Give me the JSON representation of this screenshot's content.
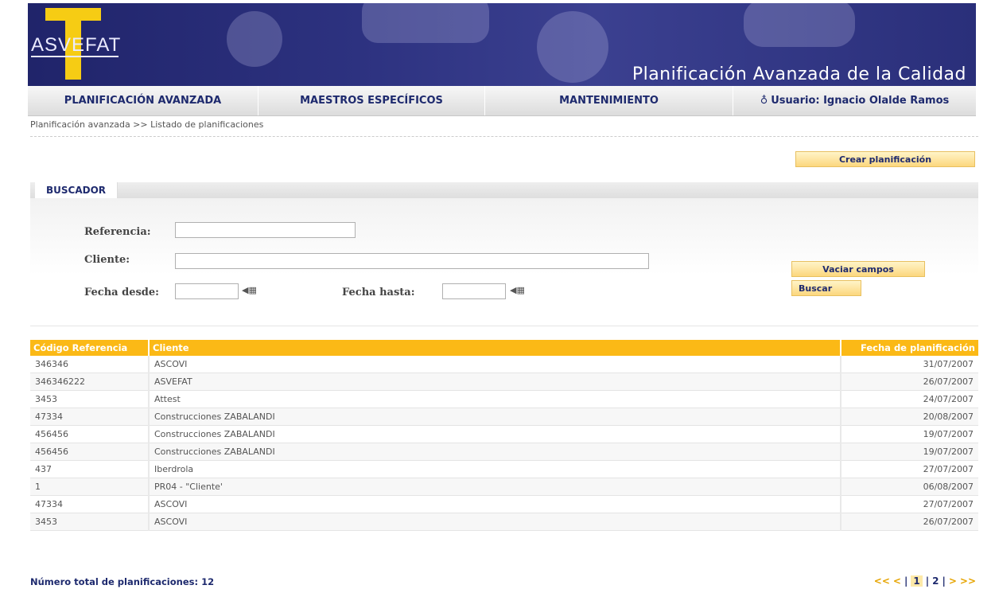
{
  "header": {
    "brand": "ASVEFAT",
    "title": "Planificación Avanzada de la Calidad"
  },
  "nav": {
    "items": [
      "PLANIFICACIÓN AVANZADA",
      "MAESTROS ESPECÍFICOS",
      "MANTENIMIENTO"
    ],
    "user": "Usuario: Ignacio Olalde Ramos"
  },
  "breadcrumb": "Planificación avanzada >> Listado de planificaciones",
  "actions": {
    "create": "Crear planificación"
  },
  "search": {
    "tab": "BUSCADOR",
    "referencia_label": "Referencia:",
    "referencia_value": "",
    "cliente_label": "Cliente:",
    "cliente_value": "",
    "fecha_desde_label": "Fecha desde:",
    "fecha_desde_value": "",
    "fecha_hasta_label": "Fecha hasta:",
    "fecha_hasta_value": "",
    "clear_button": "Vaciar campos",
    "search_button": "Buscar"
  },
  "table": {
    "headers": [
      "Código Referencia",
      "Cliente",
      "Fecha de planificación"
    ],
    "rows": [
      [
        "346346",
        "ASCOVI",
        "31/07/2007"
      ],
      [
        "346346222",
        "ASVEFAT",
        "26/07/2007"
      ],
      [
        "3453",
        "Attest",
        "24/07/2007"
      ],
      [
        "47334",
        "Construcciones ZABALANDI",
        "20/08/2007"
      ],
      [
        "456456",
        "Construcciones ZABALANDI",
        "19/07/2007"
      ],
      [
        "456456",
        "Construcciones ZABALANDI",
        "19/07/2007"
      ],
      [
        "437",
        "Iberdrola",
        "27/07/2007"
      ],
      [
        "1",
        "PR04 - \"Cliente'",
        "06/08/2007"
      ],
      [
        "47334",
        "ASCOVI",
        "27/07/2007"
      ],
      [
        "3453",
        "ASCOVI",
        "26/07/2007"
      ]
    ]
  },
  "footer": {
    "total": "Número total de planificaciones: 12",
    "pager": {
      "first": "<<",
      "prev": "<",
      "pages": [
        "1",
        "2"
      ],
      "next": ">",
      "last": ">>"
    }
  },
  "colors": {
    "banner": "#2d3280",
    "accent": "#fbb916",
    "nav_text": "#1e2a6e"
  }
}
